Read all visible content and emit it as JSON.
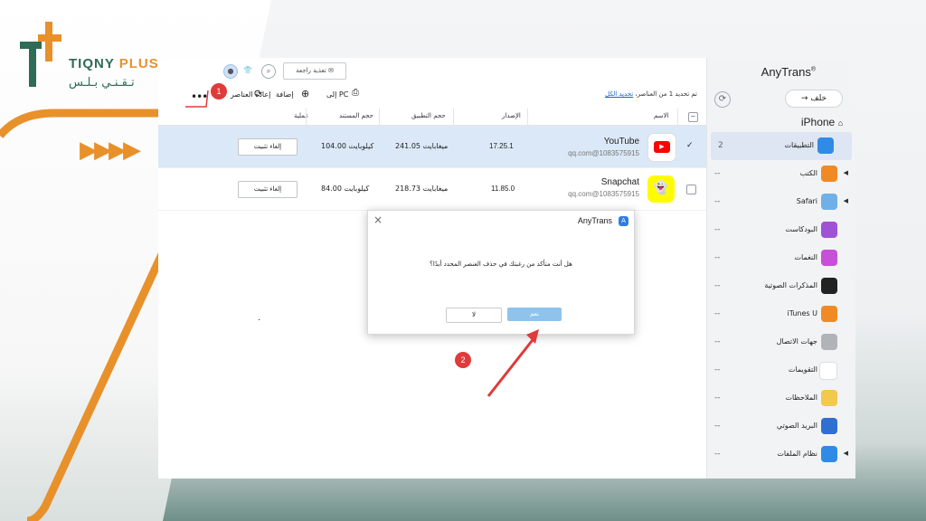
{
  "brand": {
    "name_en_main": "TIQNY ",
    "name_en_accent": "PLUS",
    "name_ar": "تـقـنـي  بـلـس"
  },
  "colors": {
    "brand_green": "#2f6b57",
    "brand_orange": "#e8912b",
    "accent_blue": "#2f7de1",
    "selection": "#dbe8f7",
    "badge_red": "#e03a3a"
  },
  "app": {
    "title": "AnyTrans",
    "title_mark": "®",
    "device": "iPhone"
  },
  "topbar": {
    "feedback": "تغذية راجعة"
  },
  "nav": {
    "back": "خلف"
  },
  "toolbar": {
    "more": "•••",
    "refresh": "إعادة العناصر",
    "add": "إضافة",
    "to_pc": "إلى PC",
    "selected_text": "تم تحديد 1 من العناصر،",
    "select_all": "تحديد الكل"
  },
  "table": {
    "headers": [
      "الاسم",
      "الإصدار",
      "حجم التطبيق",
      "حجم المستند",
      "عملية"
    ],
    "rows": [
      {
        "name": "YouTube",
        "account": "qq.com@1083575915",
        "version": "17.25.1",
        "app_size": "241.05 ميغابايت",
        "doc_size": "104.00 كيلوبايت",
        "action": "إلغاء تثبيت",
        "selected": true,
        "check": "✓"
      },
      {
        "name": "Snapchat",
        "account": "qq.com@1083575915",
        "version": "11.85.0",
        "app_size": "218.73 ميغابايت",
        "doc_size": "84.00 كيلوبايت",
        "action": "إلغاء تثبيت",
        "selected": false,
        "check": ""
      }
    ]
  },
  "sidebar": {
    "items": [
      {
        "label": "التطبيقات",
        "count": "2",
        "icon": "app-store-icon",
        "color": "#2f8be6",
        "caret": ""
      },
      {
        "label": "الكتب",
        "count": "--",
        "icon": "books-icon",
        "color": "#f08a24",
        "caret": "◀"
      },
      {
        "label": "Safari",
        "count": "--",
        "icon": "safari-icon",
        "color": "#6fb0e8",
        "caret": "◀"
      },
      {
        "label": "البودكاست",
        "count": "--",
        "icon": "podcast-icon",
        "color": "#a052d6",
        "caret": ""
      },
      {
        "label": "النغمات",
        "count": "--",
        "icon": "bell-icon",
        "color": "#c84fd8",
        "caret": ""
      },
      {
        "label": "المذكرات الصوتية",
        "count": "--",
        "icon": "voice-memo-icon",
        "color": "#222222",
        "caret": ""
      },
      {
        "label": "iTunes U",
        "count": "--",
        "icon": "itunes-u-icon",
        "color": "#f08a24",
        "caret": ""
      },
      {
        "label": "جهات الاتصال",
        "count": "--",
        "icon": "contacts-icon",
        "color": "#b0b4b8",
        "caret": ""
      },
      {
        "label": "التقويمات",
        "count": "--",
        "icon": "calendar-icon",
        "color": "#ffffff",
        "caret": ""
      },
      {
        "label": "الملاحظات",
        "count": "--",
        "icon": "notes-icon",
        "color": "#f2c94c",
        "caret": ""
      },
      {
        "label": "البريد الصوتي",
        "count": "--",
        "icon": "voicemail-icon",
        "color": "#2f6fd1",
        "caret": ""
      },
      {
        "label": "نظام الملفات",
        "count": "--",
        "icon": "file-system-icon",
        "color": "#2f8be6",
        "caret": "◀"
      }
    ]
  },
  "dialog": {
    "title": "AnyTrans",
    "message": "هل أنت متأكد من رغبتك في حذف العنصر المحدد أبدًا؟",
    "no": "لا",
    "yes": "نعم"
  },
  "annotations": {
    "badge1": "1",
    "badge2": "2"
  },
  "misc": {
    "dot": "."
  }
}
